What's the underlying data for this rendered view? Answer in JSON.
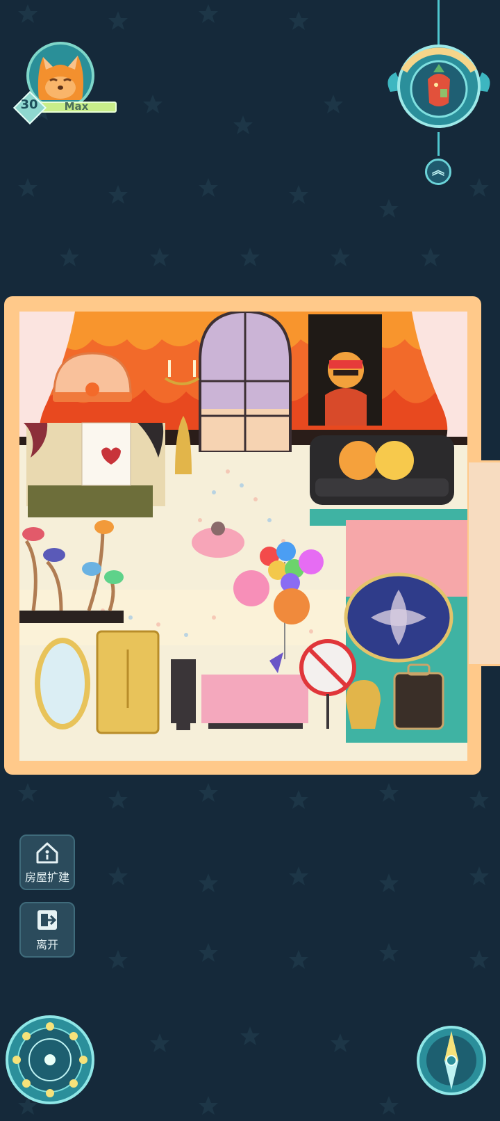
{
  "player": {
    "level": "30",
    "level_status": "Max",
    "avatar_icon": "fox-avatar-icon"
  },
  "side_buttons": {
    "expand_label": "房屋扩建",
    "leave_label": "离开"
  },
  "colors": {
    "background": "#15293a",
    "room_frame": "#ffc98a",
    "accent": "#4fc6cf"
  }
}
